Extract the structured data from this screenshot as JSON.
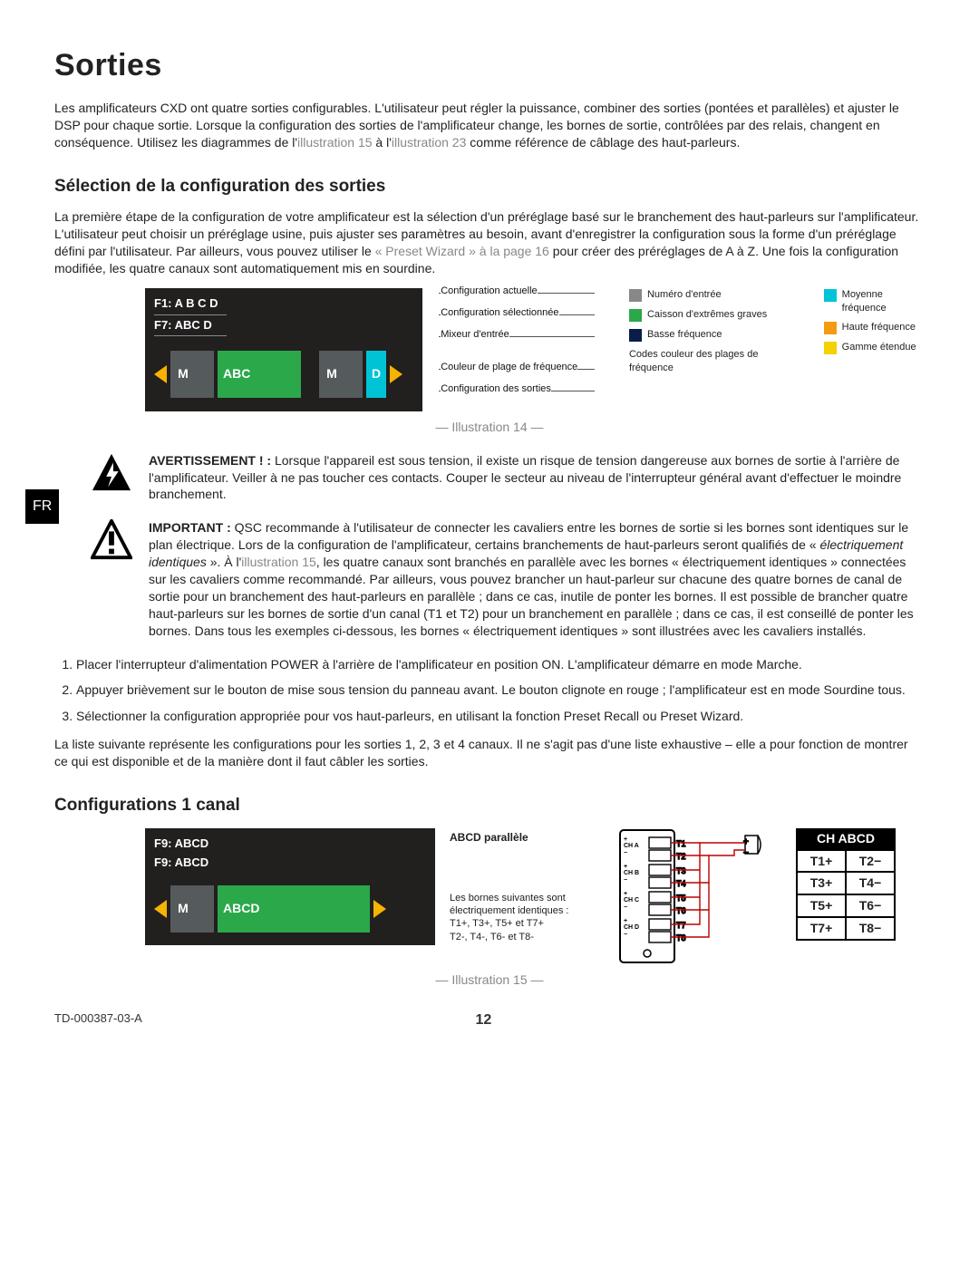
{
  "page": {
    "title": "Sorties",
    "intro": "Les amplificateurs CXD ont quatre sorties configurables. L'utilisateur peut régler la puissance, combiner des sorties (pontées et parallèles) et ajuster le DSP pour chaque sortie. Lorsque la configuration des sorties de l'amplificateur change, les bornes de sortie, contrôlées par des relais, changent en conséquence. Utilisez les diagrammes de l'",
    "intro_ref1": "illustration 15",
    "intro_mid": " à l'",
    "intro_ref2": "illustration 23",
    "intro_end": " comme référence de câblage des haut-parleurs.",
    "subtitle1": "Sélection de la configuration des sorties",
    "para2a": "La première étape de la configuration de votre amplificateur est la sélection d'un préréglage basé sur le branchement des haut-parleurs sur l'amplificateur. L'utilisateur peut choisir un préréglage usine, puis ajuster ses paramètres au besoin, avant d'enregistrer la configuration sous la forme d'un préréglage défini par l'utilisateur. Par ailleurs, vous pouvez utiliser le ",
    "para2_ref": "« Preset Wizard » à la page 16",
    "para2b": " pour créer des préréglages de A à Z. Une fois la configuration modifiée, les quatre canaux sont automatiquement mis en sourdine.",
    "side_lang": "FR",
    "caption14": "— Illustration 14 —",
    "caption15": "— Illustration 15 —",
    "warn_label": "AVERTISSEMENT ! :",
    "warn_text": " Lorsque l'appareil est sous tension, il existe un risque de tension dangereuse aux bornes de sortie à l'arrière de l'amplificateur. Veiller à ne pas toucher ces contacts. Couper le secteur au niveau de l'interrupteur général avant d'effectuer le moindre branchement.",
    "imp_label": "IMPORTANT :",
    "imp_text_a": " QSC recommande à l'utilisateur de connecter les cavaliers entre les bornes de sortie si les bornes sont identiques sur le plan électrique. Lors de la configuration de l'amplificateur, certains branchements de haut-parleurs seront qualifiés de « ",
    "imp_text_em": "électriquement identiques",
    "imp_text_b": " ». À l'",
    "imp_ref": "illustration 15",
    "imp_text_c": ", les quatre canaux sont branchés en parallèle avec les bornes « électriquement identiques » connectées sur les cavaliers comme recommandé. Par ailleurs, vous pouvez brancher un haut-parleur sur chacune des quatre bornes de canal de sortie pour un branchement des haut-parleurs en parallèle ; dans ce cas, inutile de ponter les bornes. Il est possible de brancher quatre haut-parleurs sur les bornes de sortie d'un canal (T1 et T2) pour un branchement en parallèle ; dans ce cas, il est conseillé de ponter les bornes. Dans tous les exemples ci-dessous, les bornes « électriquement identiques » sont illustrées avec les cavaliers installés.",
    "step1": "Placer l'interrupteur d'alimentation POWER à l'arrière de l'amplificateur en position ON. L'amplificateur démarre en mode Marche.",
    "step2": "Appuyer brièvement sur le bouton de mise sous tension du panneau avant. Le bouton clignote en rouge ; l'amplificateur est en mode Sourdine tous.",
    "step3": "Sélectionner la configuration appropriée pour vos haut-parleurs, en utilisant la fonction Preset Recall ou Preset Wizard.",
    "para3": "La liste suivante représente les configurations pour les sorties 1, 2, 3 et 4 canaux. Il ne s'agit pas d'une liste exhaustive – elle a pour fonction de montrer ce qui est disponible et de la manière dont il faut câbler les sorties.",
    "subtitle2": "Configurations 1 canal",
    "docnum": "TD-000387-03-A",
    "pagenum": "12"
  },
  "illus14": {
    "lcd": {
      "cur": "F1: A B C D",
      "sel": "F7: ABC D",
      "m1": "M",
      "abc": "ABC",
      "m2": "M",
      "d": "D"
    },
    "leaders": {
      "l1": "Configuration actuelle",
      "l2": "Configuration sélectionnée",
      "l3": "Mixeur d'entrée",
      "l4": "Couleur de plage de fréquence",
      "l5": "Configuration des sorties"
    },
    "legend_left": {
      "a": "Numéro d'entrée",
      "b": "Caisson d'extrêmes graves",
      "c": "Basse fréquence"
    },
    "legend_right": {
      "a": "Moyenne fréquence",
      "b": "Haute fréquence",
      "c": "Gamme étendue"
    },
    "legend_title": "Codes couleur des plages de fréquence"
  },
  "illus15": {
    "lcd": {
      "cur": "F9: ABCD",
      "sel": "F9: ABCD",
      "m": "M",
      "abcd": "ABCD"
    },
    "mid": {
      "h": "ABCD parallèle",
      "fn1": "Les bornes suivantes sont électriquement identiques :",
      "fn2": "T1+, T3+, T5+ et T7+",
      "fn3": "T2-, T4-, T6- et T8-"
    },
    "ch": {
      "hdr": "CH ABCD",
      "t1": "T1+",
      "t2": "T2−",
      "t3": "T3+",
      "t4": "T4−",
      "t5": "T5+",
      "t6": "T6−",
      "t7": "T7+",
      "t8": "T8−"
    }
  }
}
